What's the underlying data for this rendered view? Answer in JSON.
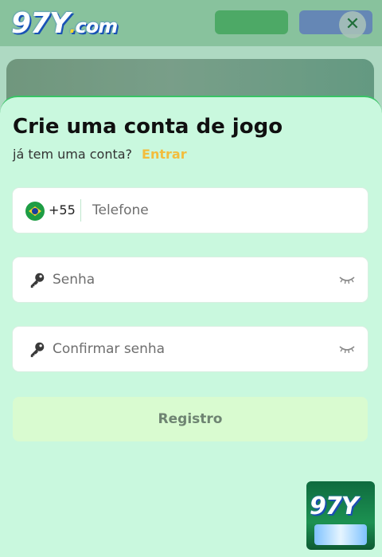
{
  "header": {
    "logo_main": "97Y",
    "logo_sep": ".",
    "logo_suffix": "com",
    "close_label": "✕"
  },
  "form": {
    "title": "Crie uma conta de jogo",
    "subtitle": "já tem uma conta?",
    "login_link": "Entrar",
    "phone": {
      "country_code": "+55",
      "placeholder": "Telefone"
    },
    "password": {
      "placeholder": "Senha"
    },
    "confirm_password": {
      "placeholder": "Confirmar senha"
    },
    "submit_label": "Registro"
  },
  "badge": {
    "text": "97Y"
  },
  "colors": {
    "accent": "#f3bd3c",
    "sheet_bg": "#c9f8de",
    "sheet_border": "#38c465",
    "submit_bg": "#d9fbd0"
  }
}
